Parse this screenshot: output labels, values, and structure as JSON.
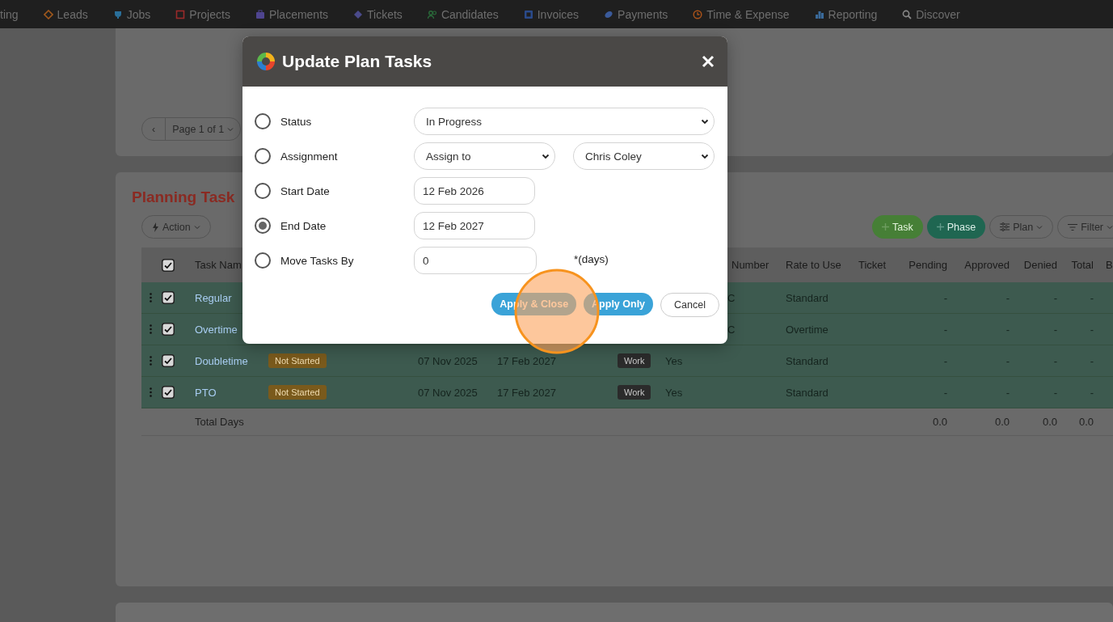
{
  "nav": {
    "items": [
      {
        "label": "ting"
      },
      {
        "label": "Leads"
      },
      {
        "label": "Jobs"
      },
      {
        "label": "Projects"
      },
      {
        "label": "Placements"
      },
      {
        "label": "Tickets"
      },
      {
        "label": "Candidates"
      },
      {
        "label": "Invoices"
      },
      {
        "label": "Payments"
      },
      {
        "label": "Time & Expense"
      },
      {
        "label": "Reporting"
      },
      {
        "label": "Discover"
      }
    ]
  },
  "pager": {
    "prev": "‹",
    "label": "Page 1 of 1"
  },
  "planning": {
    "title": "Planning Task",
    "action": "Action",
    "toolbar": [
      {
        "label": "Task",
        "kind": "add-green"
      },
      {
        "label": "Phase",
        "kind": "add-teal"
      },
      {
        "label": "Plan",
        "kind": "plan"
      },
      {
        "label": "Filter",
        "kind": "filter"
      }
    ],
    "table": {
      "select_all_checked": true,
      "columns": [
        "Task Nam",
        "Number",
        "Rate to Use",
        "Ticket",
        "Pending",
        "Approved",
        "Denied",
        "Total",
        "B"
      ],
      "rows": [
        {
          "name": "Regular",
          "checked": true,
          "number": "C",
          "rate": "Standard",
          "pending": "-",
          "approved": "-",
          "denied": "-",
          "total": "-"
        },
        {
          "name": "Overtime",
          "checked": true,
          "number": "C",
          "rate": "Overtime",
          "pending": "-",
          "approved": "-",
          "denied": "-",
          "total": "-"
        },
        {
          "name": "Doubletime",
          "checked": true,
          "status": "Not Started",
          "start": "07 Nov 2025",
          "end": "17 Feb 2027",
          "type": "Work",
          "billable": "Yes",
          "rate": "Standard",
          "pending": "-",
          "approved": "-",
          "denied": "-",
          "total": "-"
        },
        {
          "name": "PTO",
          "checked": true,
          "status": "Not Started",
          "start": "07 Nov 2025",
          "end": "17 Feb 2027",
          "type": "Work",
          "billable": "Yes",
          "rate": "Standard",
          "pending": "-",
          "approved": "-",
          "denied": "-",
          "total": "-"
        }
      ],
      "totals": {
        "label": "Total Days",
        "pending": "0.0",
        "approved": "0.0",
        "denied": "0.0",
        "total": "0.0"
      }
    }
  },
  "dialog": {
    "title": "Update Plan Tasks",
    "options": [
      {
        "label": "Status",
        "selected": false,
        "kind": "select",
        "value": "In Progress"
      },
      {
        "label": "Assignment",
        "selected": false,
        "kind": "select-pair",
        "value": "Assign to",
        "value2": "Chris Coley"
      },
      {
        "label": "Start Date",
        "selected": false,
        "kind": "date",
        "value": "12 Feb 2026"
      },
      {
        "label": "End Date",
        "selected": true,
        "kind": "date",
        "value": "12 Feb 2027"
      },
      {
        "label": "Move Tasks By",
        "selected": false,
        "kind": "number",
        "value": "0",
        "note": "*(days)"
      }
    ],
    "buttons": [
      {
        "label": "Apply & Close",
        "kind": "primary"
      },
      {
        "label": "Apply Only",
        "kind": "primary"
      },
      {
        "label": "Cancel",
        "kind": "secondary"
      }
    ]
  }
}
